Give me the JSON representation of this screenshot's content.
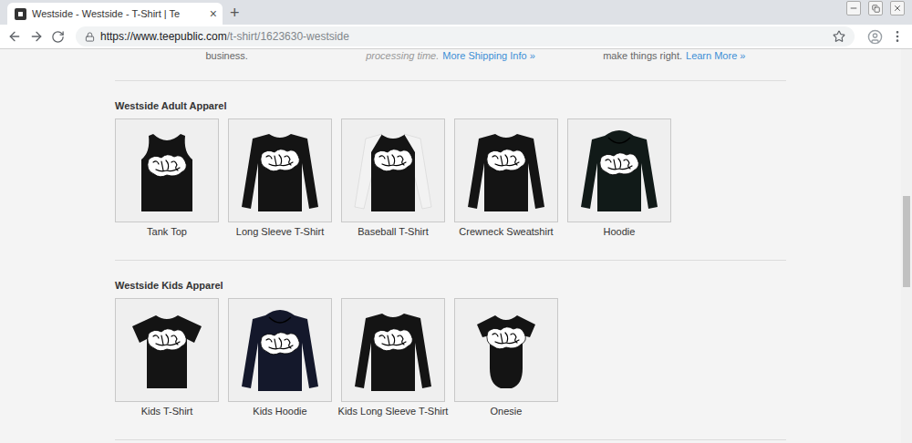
{
  "browser": {
    "tab": {
      "title": "Westside - Westside - T-Shirt | Te",
      "close": "×"
    },
    "new_tab": "+",
    "url": {
      "host": "https://www.teepublic.com",
      "path": "/t-shirt/1623630-westside"
    }
  },
  "notes": [
    {
      "parts": [
        {
          "text": "business.",
          "kind": "plain"
        }
      ]
    },
    {
      "parts": [
        {
          "text": "processing time.",
          "kind": "italic"
        },
        {
          "text": "More Shipping Info »",
          "kind": "link"
        }
      ]
    },
    {
      "parts": [
        {
          "text": "make things right.",
          "kind": "plain"
        },
        {
          "text": "Learn More »",
          "kind": "link"
        }
      ]
    }
  ],
  "sections": [
    {
      "title": "Westside Adult Apparel",
      "items": [
        {
          "label": "Tank Top",
          "kind": "tank"
        },
        {
          "label": "Long Sleeve T-Shirt",
          "kind": "long"
        },
        {
          "label": "Baseball T-Shirt",
          "kind": "baseball"
        },
        {
          "label": "Crewneck Sweatshirt",
          "kind": "crewneck"
        },
        {
          "label": "Hoodie",
          "kind": "hoodie"
        }
      ]
    },
    {
      "title": "Westside Kids Apparel",
      "items": [
        {
          "label": "Kids T-Shirt",
          "kind": "tee"
        },
        {
          "label": "Kids Hoodie",
          "kind": "kidshoodie"
        },
        {
          "label": "Kids Long Sleeve T-Shirt",
          "kind": "long"
        },
        {
          "label": "Onesie",
          "kind": "onesie"
        }
      ]
    }
  ]
}
